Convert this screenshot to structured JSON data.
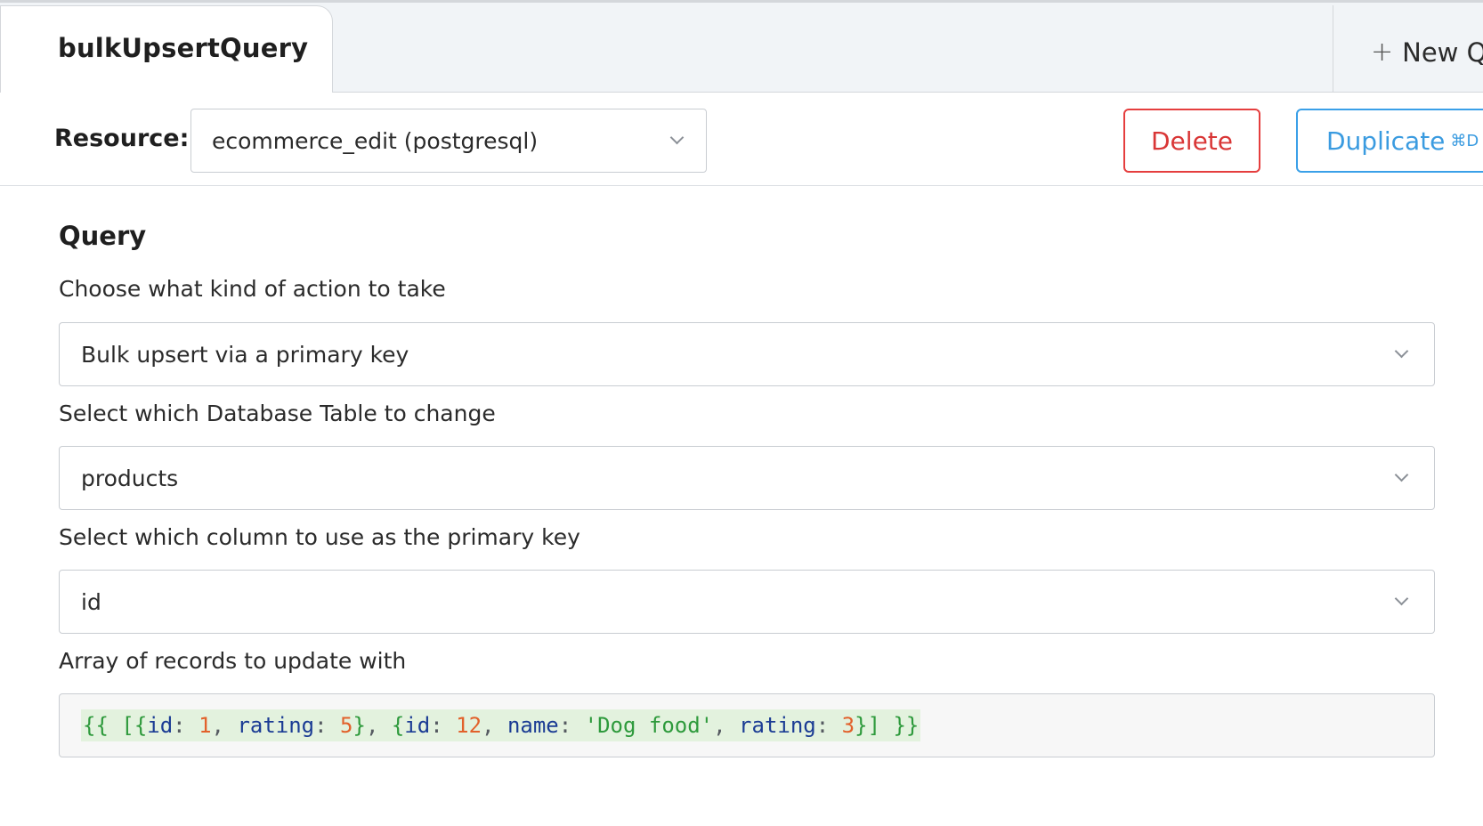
{
  "tabs": {
    "active_label": "bulkUpsertQuery",
    "new_label": "New Q"
  },
  "resource": {
    "label": "Resource:",
    "selected": "ecommerce_edit (postgresql)"
  },
  "actions": {
    "delete_label": "Delete",
    "duplicate_label": "Duplicate",
    "duplicate_shortcut": "⌘D"
  },
  "query": {
    "title": "Query",
    "action_label": "Choose what kind of action to take",
    "action_value": "Bulk upsert via a primary key",
    "table_label": "Select which Database Table to change",
    "table_value": "products",
    "pk_label": "Select which column to use as the primary key",
    "pk_value": "id",
    "records_label": "Array of records to update with",
    "records_value": "{{ [{id: 1, rating: 5}, {id: 12, name: 'Dog food', rating: 3}] }}"
  },
  "colors": {
    "delete": "#e53e3e",
    "duplicate": "#3aa0e8",
    "code_highlight": "#e3f2de",
    "code_key": "#1b3c94",
    "code_number": "#e2612b",
    "code_string": "#2e9a3c"
  },
  "icons": {
    "new_tab": "plus-icon",
    "dropdown": "chevron-down-icon"
  }
}
